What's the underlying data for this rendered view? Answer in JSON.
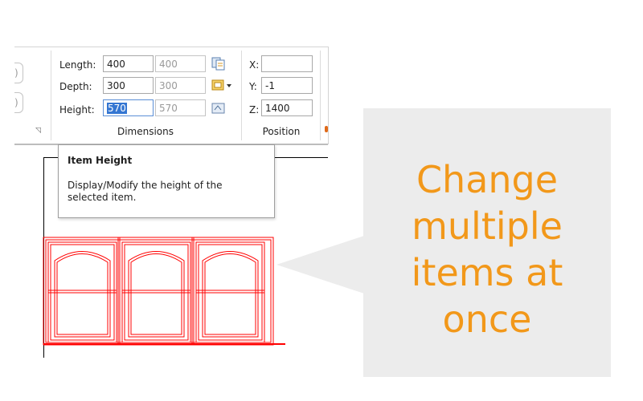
{
  "dimensions": {
    "length_label": "Length:",
    "length_value": "400",
    "length_alt": "400",
    "depth_label": "Depth:",
    "depth_value": "300",
    "depth_alt": "300",
    "height_label": "Height:",
    "height_value": "570",
    "height_alt": "570",
    "group_label": "Dimensions"
  },
  "position": {
    "x_label": "X:",
    "x_value": "",
    "y_label": "Y:",
    "y_value": "-1",
    "z_label": "Z:",
    "z_value": "1400",
    "group_label": "Position"
  },
  "left_group": {
    "field1_fragment": ")",
    "field2_fragment": ")"
  },
  "tooltip": {
    "title": "Item Height",
    "body": "Display/Modify the height of the selected item."
  },
  "callout": {
    "text": "Change\nmultiple\nitems at\nonce",
    "color": "#f2981a",
    "background": "#ececec"
  },
  "cabinet": {
    "count": 3,
    "line_color": "#ff0000"
  },
  "icons": [
    "copy-dimensions-icon",
    "dimension-options-dropdown-icon",
    "swap-dimensions-icon"
  ]
}
